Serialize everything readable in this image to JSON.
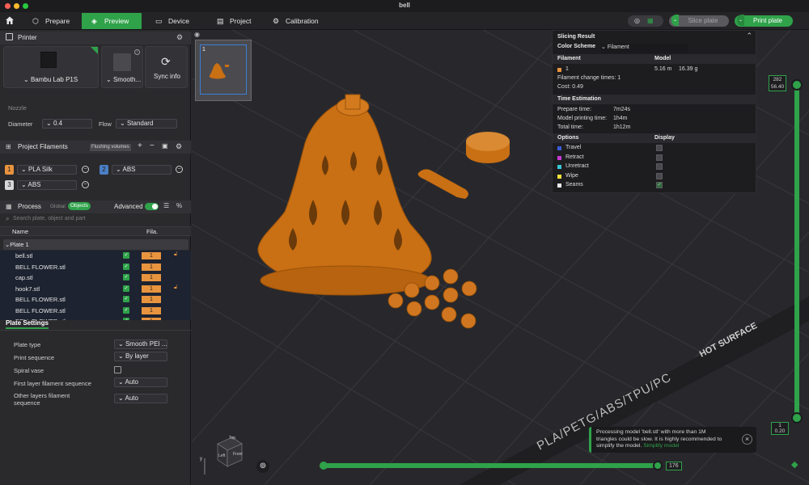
{
  "window": {
    "title": "bell"
  },
  "tabs": [
    {
      "label": "Prepare"
    },
    {
      "label": "Preview"
    },
    {
      "label": "Device"
    },
    {
      "label": "Project"
    },
    {
      "label": "Calibration"
    }
  ],
  "toolbar": {
    "slice_label": "Slice plate",
    "print_label": "Print plate"
  },
  "printer": {
    "section_label": "Printer",
    "name": "Bambu Lab P1S",
    "plate": "Smooth...",
    "sync_label": "Sync info",
    "nozzle_label": "Nozzle",
    "diameter_label": "Diameter",
    "diameter_value": "0.4",
    "flow_label": "Flow",
    "flow_value": "Standard"
  },
  "filaments": {
    "section_label": "Project Filaments",
    "flushing_label": "Flushing volumes",
    "items": [
      {
        "num": "1",
        "name": "PLA Silk",
        "color": "#e8943e"
      },
      {
        "num": "2",
        "name": "ABS",
        "color": "#4a7fc4"
      },
      {
        "num": "3",
        "name": "ABS",
        "color": "#d8d8d8"
      }
    ]
  },
  "process": {
    "section_label": "Process",
    "global_label": "Global",
    "objects_label": "Objects",
    "advanced_label": "Advanced",
    "search_placeholder": "Search plate, object and part",
    "col_name": "Name",
    "col_fila": "Fila.",
    "plate_label": "Plate 1",
    "objects": [
      {
        "name": "bell.stl",
        "fila": "1",
        "lock": true
      },
      {
        "name": "BELL FLOWER.stl",
        "fila": "1",
        "lock": false
      },
      {
        "name": "cap.stl",
        "fila": "1",
        "lock": false
      },
      {
        "name": "hook7.stl",
        "fila": "1",
        "lock": true
      },
      {
        "name": "BELL FLOWER.stl",
        "fila": "1",
        "lock": false
      },
      {
        "name": "BELL FLOWER.stl",
        "fila": "1",
        "lock": false
      },
      {
        "name": "BELL FLOWER.stl",
        "fila": "1",
        "lock": false
      }
    ]
  },
  "plate_settings": {
    "section_label": "Plate Settings",
    "plate_type_label": "Plate type",
    "plate_type_value": "Smooth PEI ...",
    "print_seq_label": "Print sequence",
    "print_seq_value": "By layer",
    "spiral_label": "Spiral vase",
    "first_layer_label": "First layer filament sequence",
    "first_layer_value": "Auto",
    "other_layers_label_1": "Other layers filament",
    "other_layers_label_2": "sequence",
    "other_layers_value": "Auto"
  },
  "thumbnail": {
    "index": "1"
  },
  "slicing_result": {
    "title": "Slicing Result",
    "color_scheme_label": "Color Scheme",
    "color_scheme_value": "Filament",
    "filament_col": "Filament",
    "model_col": "Model",
    "filament_num": "1",
    "model_length": "5.16 m",
    "model_weight": "16.39 g",
    "change_times": "Filament change times:  1",
    "cost": "Cost:  0.49",
    "time_title": "Time Estimation",
    "prepare_label": "Prepare time:",
    "prepare_value": "7m24s",
    "model_time_label": "Model printing time:",
    "model_time_value": "1h4m",
    "total_label": "Total time:",
    "total_value": "1h12m",
    "options_col": "Options",
    "display_col": "Display",
    "options": [
      {
        "name": "Travel",
        "color": "#3a5bd6",
        "checked": false
      },
      {
        "name": "Retract",
        "color": "#c83ad6",
        "checked": false
      },
      {
        "name": "Unretract",
        "color": "#3ac6d6",
        "checked": false
      },
      {
        "name": "Wipe",
        "color": "#f2e23a",
        "checked": false
      },
      {
        "name": "Seams",
        "color": "#ececec",
        "checked": true
      }
    ]
  },
  "layers": {
    "top_value_1": "282",
    "top_value_2": "56.40",
    "bottom_value_1": "1",
    "bottom_value_2": "0.20",
    "horizontal_value": "176"
  },
  "bed_text": {
    "surface": "HOT SURFACE",
    "materials": "PLA/PETG/ABS/TPU/PC"
  },
  "view_cube": {
    "top": "Top",
    "left": "Left",
    "front": "Front"
  },
  "toast": {
    "line1": "Processing model 'bell.stl' with more than 1M",
    "line2": "triangles could be slow. It is highly recommended to",
    "line3": "simplify the model.",
    "link": "Simplify model"
  }
}
